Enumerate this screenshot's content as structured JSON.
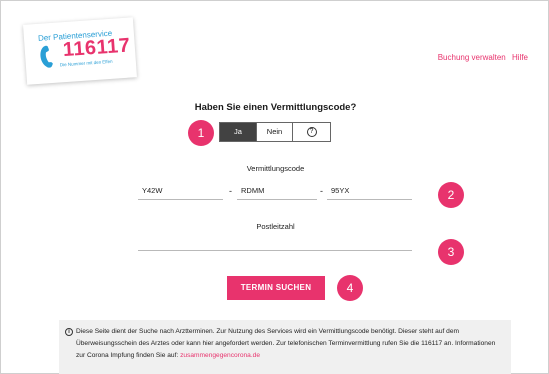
{
  "logo": {
    "title": "Der Patientenservice",
    "number": "116117",
    "tagline": "Die Nummer mit den Elfen"
  },
  "nav": {
    "manage_booking": "Buchung verwalten",
    "help": "Hilfe"
  },
  "question": "Haben Sie einen Vermittlungscode?",
  "toggle": {
    "yes": "Ja",
    "no": "Nein",
    "help_icon": "?"
  },
  "badges": [
    "1",
    "2",
    "3",
    "4"
  ],
  "code": {
    "label": "Vermittlungscode",
    "part1": "Y42W",
    "part2": "RDMM",
    "part3": "95YX",
    "separator": "-"
  },
  "postcode": {
    "label": "Postleitzahl",
    "value": ""
  },
  "search_button": "TERMIN SUCHEN",
  "info": {
    "icon": "i",
    "text": "Diese Seite dient der Suche nach Arztterminen. Zur Nutzung des Services wird ein Vermittlungscode benötigt. Dieser steht auf dem Überweisungsschein des Arztes oder kann hier angefordert werden. Zur telefonischen Terminvermittlung rufen Sie die 116117 an. Informationen zur Corona Impfung finden Sie auf: ",
    "link": "zusammengegencorona.de"
  },
  "colors": {
    "brand_pink": "#e8336d",
    "brand_blue": "#2a9fd6",
    "toggle_active": "#424242"
  }
}
